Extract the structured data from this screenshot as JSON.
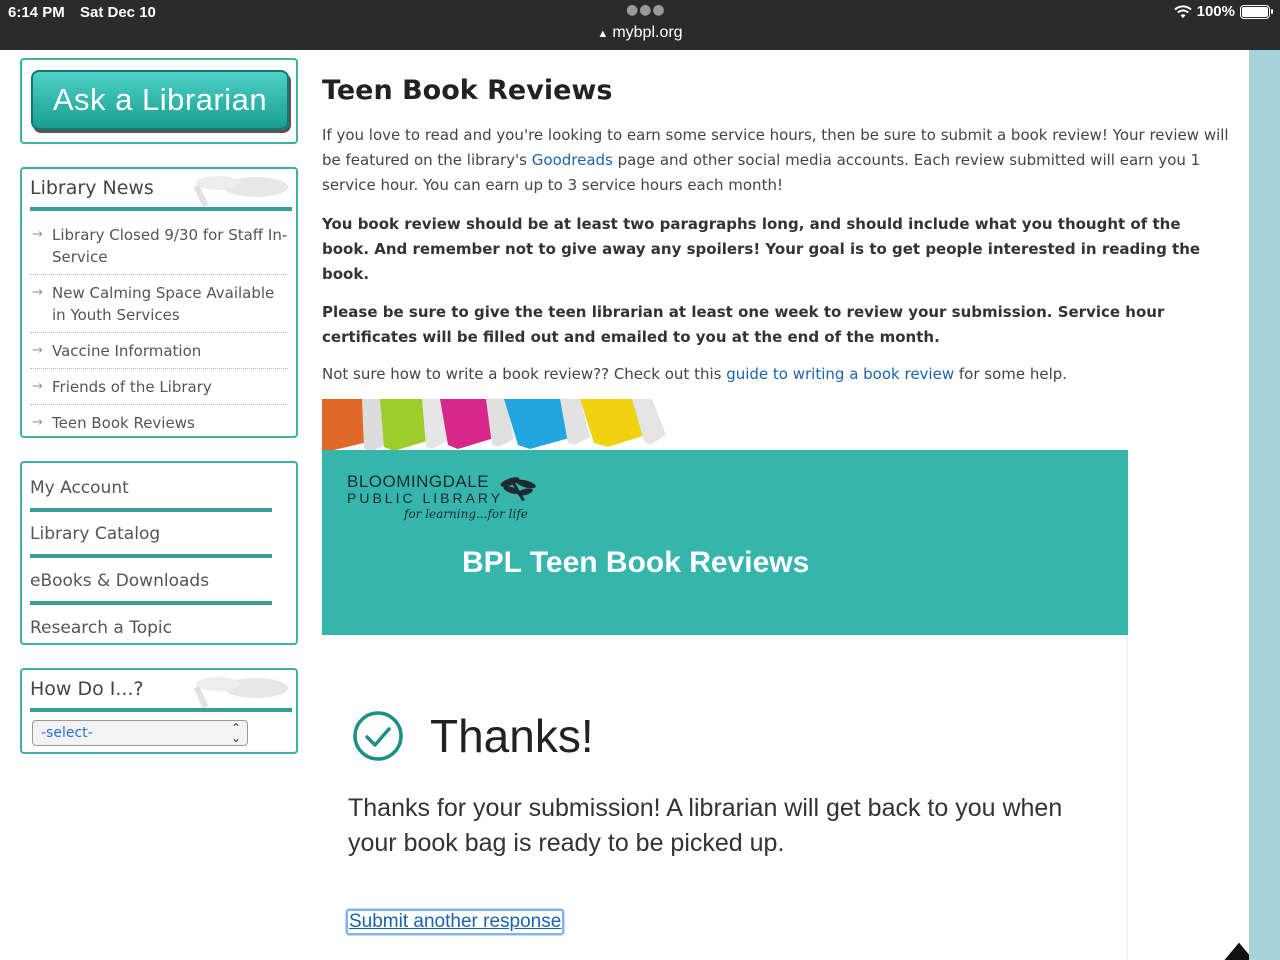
{
  "status_bar": {
    "time": "6:14 PM",
    "date": "Sat Dec 10",
    "url": "mybpl.org",
    "battery": "100%"
  },
  "sidebar": {
    "ask_button": "Ask a Librarian",
    "news": {
      "title": "Library News",
      "items": [
        "Library Closed 9/30 for Staff In-Service",
        "New Calming Space Available in Youth Services",
        "Vaccine Information",
        "Friends of the Library",
        "Teen Book Reviews"
      ]
    },
    "account_links": [
      "My Account",
      "Library Catalog",
      "eBooks & Downloads",
      "Research a Topic"
    ],
    "how_do_i": {
      "title": "How Do I...?",
      "select_value": "-select-"
    }
  },
  "main": {
    "title": "Teen Book Reviews",
    "intro_before": "If you love to read and you're looking to earn some service hours, then be sure to submit a book review! Your review will be featured on the library's ",
    "intro_link": "Goodreads",
    "intro_after": " page and other social media accounts. Each review submitted will earn you 1 service hour. You can earn up to 3 service hours each month!",
    "bold_1": "You book review should be at least two paragraphs long, and should include what you thought of the book. And remember not to give away any spoilers! Your goal is to get people interested in reading the book.",
    "bold_2": "Please be sure to give the teen librarian at least one week to review your submission. Service hour certificates will be filled out and emailed to you at the end of the month.",
    "guide_before": "Not sure how to write a book review?? Check out this ",
    "guide_link": "guide to writing a book review",
    "guide_after": " for some help."
  },
  "banner": {
    "library_name_line1": "BLOOMINGDALE",
    "library_name_line2": "PUBLIC LIBRARY",
    "tagline": "for learning...for life",
    "title": "BPL Teen Book Reviews"
  },
  "form_result": {
    "heading": "Thanks!",
    "message": "Thanks for your submission! A librarian will get back to you when your book bag is ready to be picked up.",
    "link": "Submit another response"
  },
  "colors": {
    "accent_teal": "#36b5ac",
    "status_bar": "#2b2b2b",
    "link": "#1a63b0",
    "right_strip": "#a6d2dc"
  }
}
